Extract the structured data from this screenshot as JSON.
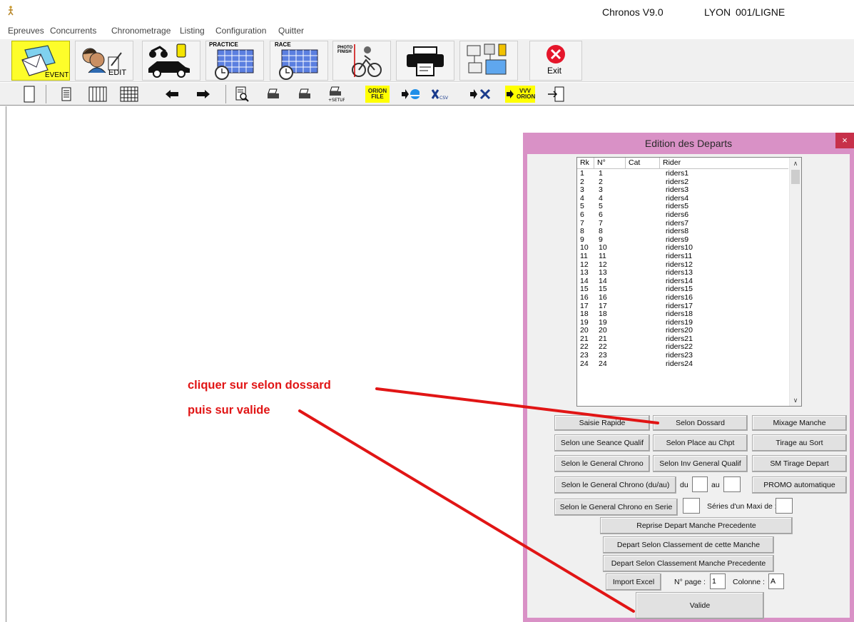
{
  "window": {
    "title": "Chronos V9.0",
    "location": "LYON  001/LIGNE"
  },
  "menu": [
    "Epreuves",
    "Concurrents",
    "Chronometrage",
    "Listing",
    "Configuration",
    "Quitter"
  ],
  "toolbar_main": [
    {
      "name": "event-button",
      "icon": "event-envelope-icon",
      "caption": "EVENT"
    },
    {
      "name": "edit-concurrents-button",
      "icon": "people-edit-icon",
      "caption": "EDIT"
    },
    {
      "name": "vehicles-button",
      "icon": "vehicles-icon",
      "caption": ""
    },
    {
      "name": "practice-button",
      "icon": "practice-calendar-icon",
      "caption": "PRACTICE"
    },
    {
      "name": "race-button",
      "icon": "race-calendar-icon",
      "caption": "RACE"
    },
    {
      "name": "photo-finish-button",
      "icon": "photo-finish-cyclist-icon",
      "caption": "PHOTO FINISH"
    },
    {
      "name": "print-button",
      "icon": "printer-icon",
      "caption": ""
    },
    {
      "name": "network-button",
      "icon": "network-computers-icon",
      "caption": ""
    },
    {
      "name": "exit-button",
      "icon": "exit-x-icon",
      "caption": "Exit"
    }
  ],
  "toolbar_sub": {
    "orion_file": "ORION FILE",
    "vvv_orion": "VVV ORION",
    "csv": "CSV"
  },
  "dialog": {
    "title": "Edition des Departs",
    "close": "×",
    "columns": [
      "Rk",
      "N°",
      "Cat",
      "Rider"
    ],
    "rows": [
      [
        "1",
        "1",
        "",
        "riders1"
      ],
      [
        "2",
        "2",
        "",
        "riders2"
      ],
      [
        "3",
        "3",
        "",
        "riders3"
      ],
      [
        "4",
        "4",
        "",
        "riders4"
      ],
      [
        "5",
        "5",
        "",
        "riders5"
      ],
      [
        "6",
        "6",
        "",
        "riders6"
      ],
      [
        "7",
        "7",
        "",
        "riders7"
      ],
      [
        "8",
        "8",
        "",
        "riders8"
      ],
      [
        "9",
        "9",
        "",
        "riders9"
      ],
      [
        "10",
        "10",
        "",
        "riders10"
      ],
      [
        "11",
        "11",
        "",
        "riders11"
      ],
      [
        "12",
        "12",
        "",
        "riders12"
      ],
      [
        "13",
        "13",
        "",
        "riders13"
      ],
      [
        "14",
        "14",
        "",
        "riders14"
      ],
      [
        "15",
        "15",
        "",
        "riders15"
      ],
      [
        "16",
        "16",
        "",
        "riders16"
      ],
      [
        "17",
        "17",
        "",
        "riders17"
      ],
      [
        "18",
        "18",
        "",
        "riders18"
      ],
      [
        "19",
        "19",
        "",
        "riders19"
      ],
      [
        "20",
        "20",
        "",
        "riders20"
      ],
      [
        "21",
        "21",
        "",
        "riders21"
      ],
      [
        "22",
        "22",
        "",
        "riders22"
      ],
      [
        "23",
        "23",
        "",
        "riders23"
      ],
      [
        "24",
        "24",
        "",
        "riders24"
      ]
    ],
    "buttons": {
      "saisie_rapide": "Saisie Rapide",
      "selon_dossard": "Selon Dossard",
      "mixage_manche": "Mixage Manche",
      "selon_seance_qualif": "Selon une Seance Qualif",
      "selon_place_chpt": "Selon Place au Chpt",
      "tirage_au_sort": "Tirage au Sort",
      "selon_general_chrono": "Selon le General Chrono",
      "selon_inv_general_qualif": "Selon Inv General Qualif",
      "sm_tirage_depart": "SM Tirage Depart",
      "selon_general_chrono_du_au": "Selon le General Chrono (du/au)",
      "promo_automatique": "PROMO automatique",
      "selon_general_chrono_serie": "Selon le General Chrono en Serie",
      "reprise_depart": "Reprise Depart Manche Precedente",
      "depart_classement_cette_manche": "Depart Selon Classement de cette Manche",
      "depart_classement_manche_precedente": "Depart Selon Classement Manche Precedente",
      "import_excel": "Import Excel",
      "valide": "Valide"
    },
    "labels": {
      "du": "du",
      "au": "au",
      "series_maxi": "Séries d'un Maxi de :",
      "n_page": "N° page :",
      "colonne": "Colonne :"
    },
    "inputs": {
      "du": "",
      "au": "",
      "series_count": "",
      "series_maxi": "",
      "n_page": "1",
      "colonne": "A"
    }
  },
  "annotations": {
    "line1": "cliquer sur selon dossard",
    "line2": "puis sur valide",
    "color": "#e11515"
  }
}
